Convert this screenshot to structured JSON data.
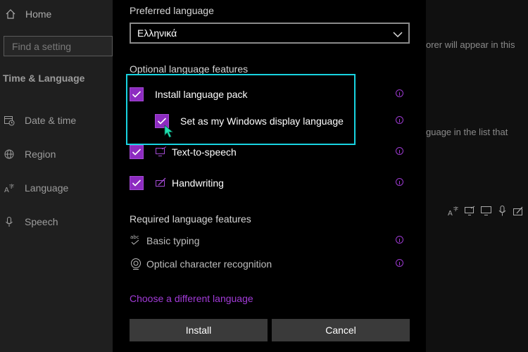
{
  "sidebar": {
    "home_label": "Home",
    "search_placeholder": "Find a setting",
    "section_title": "Time & Language",
    "items": [
      {
        "label": "Date & time",
        "icon": "calendar-clock-icon"
      },
      {
        "label": "Region",
        "icon": "globe-icon"
      },
      {
        "label": "Language",
        "icon": "language-icon"
      },
      {
        "label": "Speech",
        "icon": "microphone-icon"
      }
    ]
  },
  "background_page": {
    "text_fragment_1": "orer will appear in this",
    "text_fragment_2": "guage in the list that",
    "feature_icons": [
      "language-icon",
      "text-to-speech-icon",
      "display-icon",
      "microphone-icon",
      "handwriting-icon",
      "basic-typing-icon"
    ]
  },
  "dialog": {
    "preferred_label": "Preferred language",
    "selected_language": "Ελληνικά",
    "optional_title": "Optional language features",
    "optional_features": [
      {
        "label": "Install language pack",
        "checked": true
      },
      {
        "label": "Set as my Windows display language",
        "checked": true
      },
      {
        "label": "Text-to-speech",
        "checked": true,
        "icon": "text-to-speech-icon"
      },
      {
        "label": "Handwriting",
        "checked": true,
        "icon": "handwriting-icon"
      }
    ],
    "required_title": "Required language features",
    "required_features": [
      {
        "label": "Basic typing",
        "icon": "basic-typing-icon"
      },
      {
        "label": "Optical character recognition",
        "icon": "ocr-icon"
      }
    ],
    "choose_link": "Choose a different language",
    "install_button": "Install",
    "cancel_button": "Cancel"
  },
  "colors": {
    "accent": "#8d2bc1",
    "link": "#a23bd8",
    "highlight": "#18d3e1"
  }
}
